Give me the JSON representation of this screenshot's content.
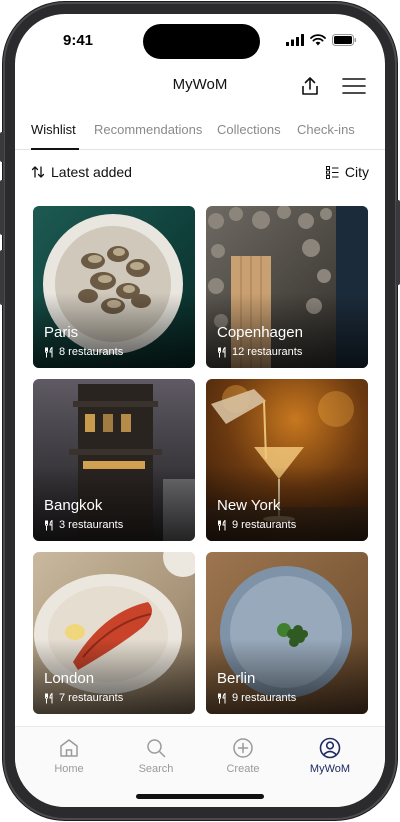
{
  "status": {
    "time": "9:41"
  },
  "header": {
    "title": "MyWoM"
  },
  "tabs": [
    {
      "label": "Wishlist"
    },
    {
      "label": "Recommendations"
    },
    {
      "label": "Collections"
    },
    {
      "label": "Check-ins"
    }
  ],
  "sort": {
    "label": "Latest added"
  },
  "group": {
    "label": "City"
  },
  "cards": [
    {
      "city": "Paris",
      "count": "8 restaurants"
    },
    {
      "city": "Copenhagen",
      "count": "12 restaurants"
    },
    {
      "city": "Bangkok",
      "count": "3 restaurants"
    },
    {
      "city": "New York",
      "count": "9 restaurants"
    },
    {
      "city": "London",
      "count": "7 restaurants"
    },
    {
      "city": "Berlin",
      "count": "9 restaurants"
    }
  ],
  "tabbar": [
    {
      "label": "Home",
      "icon": "home-icon"
    },
    {
      "label": "Search",
      "icon": "search-icon"
    },
    {
      "label": "Create",
      "icon": "plus-circle-icon"
    },
    {
      "label": "MyWoM",
      "icon": "profile-icon"
    }
  ],
  "colors": {
    "accent": "#1f2a63",
    "inactive": "#9a9a9a"
  }
}
